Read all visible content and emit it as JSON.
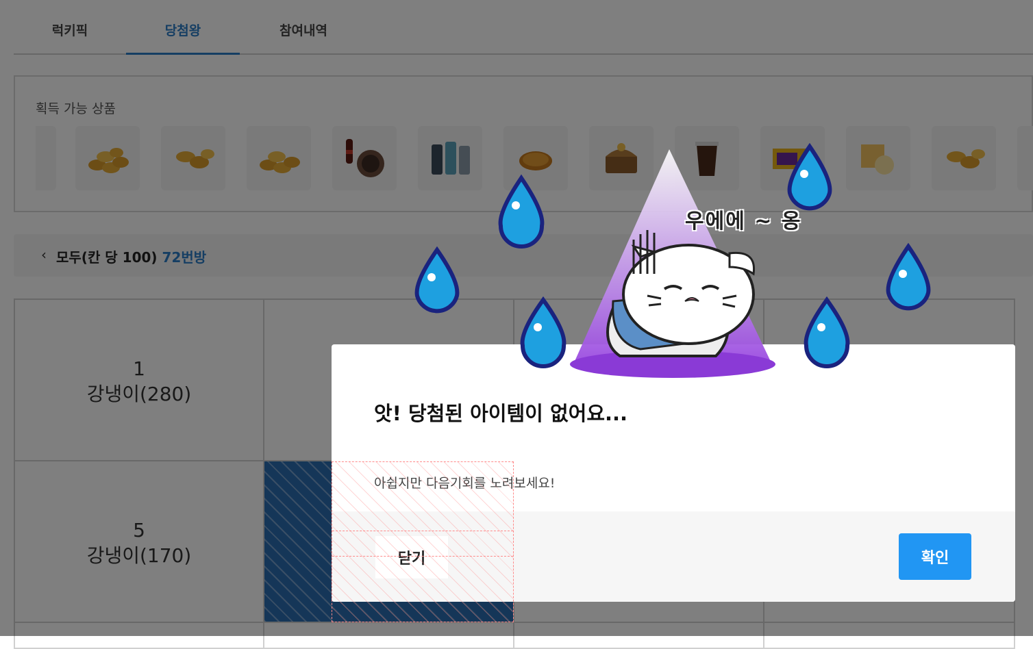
{
  "tabs": [
    {
      "label": "럭키픽",
      "active": false
    },
    {
      "label": "당첨왕",
      "active": true
    },
    {
      "label": "참여내역",
      "active": false
    }
  ],
  "prizes": {
    "title": "획득 가능 상품",
    "items": [
      {
        "icon": "gold-coin-pile-icon"
      },
      {
        "icon": "gold-coin-pair-icon"
      },
      {
        "icon": "gold-coin-pile-icon"
      },
      {
        "icon": "cola-and-food-icon"
      },
      {
        "icon": "bottles-icon"
      },
      {
        "icon": "gold-medal-icon"
      },
      {
        "icon": "treasure-chest-icon"
      },
      {
        "icon": "iced-coffee-icon"
      },
      {
        "icon": "snack-box-icon"
      },
      {
        "icon": "cake-icon"
      },
      {
        "icon": "gold-coin-pair-icon"
      }
    ]
  },
  "room": {
    "back_icon": "chevron-left-icon",
    "name": "모두(칸 당 100)",
    "number": "72번방"
  },
  "grid": {
    "rows": [
      {
        "num": "1",
        "label": "강냉이(280)"
      },
      {
        "num": "5",
        "label": "강냉이(170)"
      }
    ]
  },
  "modal": {
    "caption": "우에에 ~ 옹",
    "title": "앗! 당첨된 아이템이 없어요...",
    "message": "아쉽지만 다음기회를 노려보세요!",
    "close_label": "닫기",
    "confirm_label": "확인",
    "confirm_color": "#2196f3"
  },
  "colors": {
    "accent": "#2a7cc7"
  }
}
